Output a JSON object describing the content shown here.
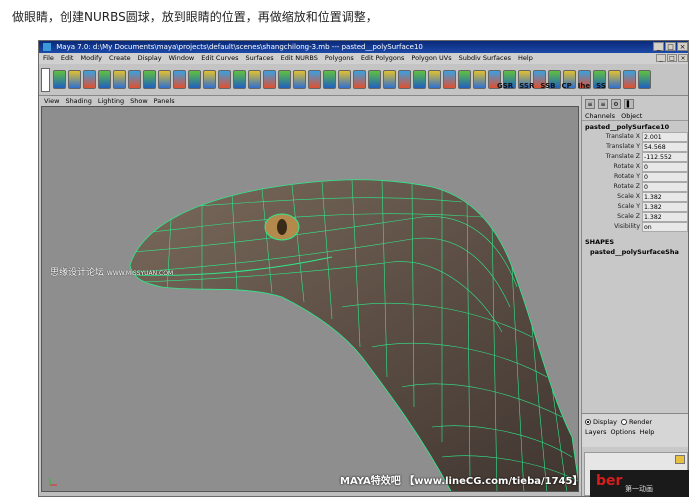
{
  "caption": "做眼睛，创建NURBS圆球，放到眼睛的位置，再做缩放和位置调整，",
  "window": {
    "title": "Maya 7.0: d:\\My Documents\\maya\\projects\\default\\scenes\\shangchilong-3.mb  ---  pasted__polySurface10",
    "buttons": [
      "_",
      "□",
      "×"
    ]
  },
  "menubar": {
    "items": [
      "File",
      "Edit",
      "Modify",
      "Create",
      "Display",
      "Window",
      "Edit Curves",
      "Surfaces",
      "Edit NURBS",
      "Polygons",
      "Edit Polygons",
      "Polygon UVs",
      "Subdiv Surfaces",
      "Help"
    ]
  },
  "shelf": {
    "labels": [
      "GSR",
      "SSR",
      "SSB",
      "CP",
      "Ihe",
      "SS"
    ]
  },
  "panel_menu": {
    "items": [
      "View",
      "Shading",
      "Lighting",
      "Show",
      "Panels"
    ]
  },
  "channel_box": {
    "tabs": [
      "Channels",
      "Object"
    ],
    "node": "pasted__polySurface10",
    "attributes": [
      {
        "name": "Translate X",
        "value": "2.001"
      },
      {
        "name": "Translate Y",
        "value": "54.568"
      },
      {
        "name": "Translate Z",
        "value": "-112.552"
      },
      {
        "name": "Rotate X",
        "value": "0"
      },
      {
        "name": "Rotate Y",
        "value": "0"
      },
      {
        "name": "Rotate Z",
        "value": "0"
      },
      {
        "name": "Scale X",
        "value": "1.382"
      },
      {
        "name": "Scale Y",
        "value": "1.382"
      },
      {
        "name": "Scale Z",
        "value": "1.382"
      },
      {
        "name": "Visibility",
        "value": "on"
      }
    ],
    "shapes_header": "SHAPES",
    "shape_node": "pasted__polySurfaceSha"
  },
  "layer_editor": {
    "display_label": "Display",
    "render_label": "Render",
    "menu": [
      "Layers",
      "Options",
      "Help"
    ]
  },
  "watermarks": {
    "forum": "思缘设计论坛",
    "forum_url": "WWW.MISSYUAN.COM",
    "site": "MAYA特效吧  【www.lineCG.com/tieba/1745】",
    "brand": "ber",
    "brand_sub": "第一动画"
  },
  "colors": {
    "wireframe": "#2ee88a",
    "viewport_bg": "#8e8e8e",
    "titlebar": "#0a2a7a"
  }
}
